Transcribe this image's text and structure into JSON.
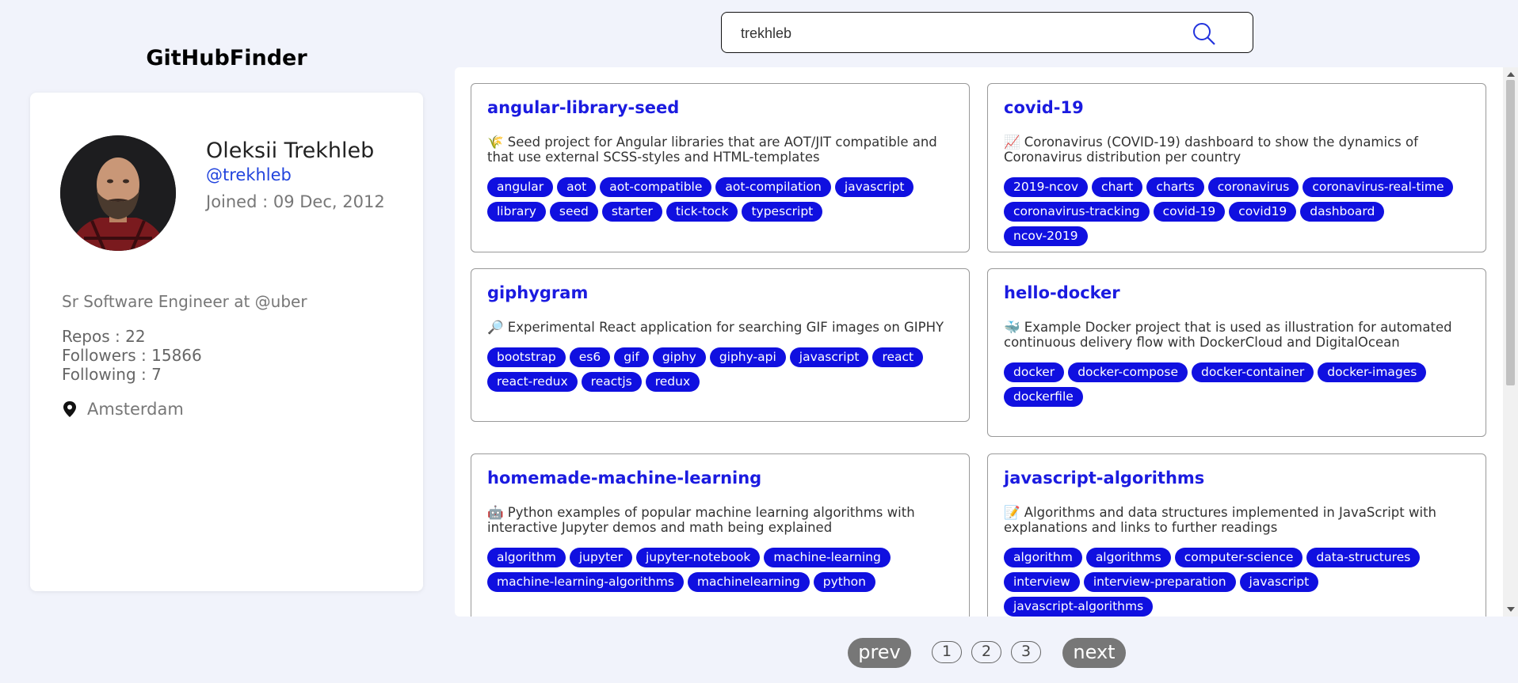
{
  "app": {
    "title": "GitHubFinder"
  },
  "search": {
    "value": "trekhleb"
  },
  "profile": {
    "name": "Oleksii Trekhleb",
    "login": "@trekhleb",
    "joined": "Joined : 09 Dec, 2012",
    "bio": "Sr Software Engineer at @uber",
    "repos": "Repos : 22",
    "followers": "Followers : 15866",
    "following": "Following : 7",
    "location": "Amsterdam"
  },
  "repos": [
    {
      "name": "angular-library-seed",
      "description": "🌾 Seed project for Angular libraries that are AOT/JIT compatible and that use external SCSS-styles and HTML-templates",
      "topics": [
        "angular",
        "aot",
        "aot-compatible",
        "aot-compilation",
        "javascript",
        "library",
        "seed",
        "starter",
        "tick-tock",
        "typescript"
      ]
    },
    {
      "name": "covid-19",
      "description": "📈 Coronavirus (COVID-19) dashboard to show the dynamics of Coronavirus distribution per country",
      "topics": [
        "2019-ncov",
        "chart",
        "charts",
        "coronavirus",
        "coronavirus-real-time",
        "coronavirus-tracking",
        "covid-19",
        "covid19",
        "dashboard",
        "ncov-2019"
      ]
    },
    {
      "name": "giphygram",
      "description": "🔎 Experimental React application for searching GIF images on GIPHY",
      "topics": [
        "bootstrap",
        "es6",
        "gif",
        "giphy",
        "giphy-api",
        "javascript",
        "react",
        "react-redux",
        "reactjs",
        "redux"
      ]
    },
    {
      "name": "hello-docker",
      "description": "🐳 Example Docker project that is used as illustration for automated continuous delivery flow with DockerCloud and DigitalOcean",
      "topics": [
        "docker",
        "docker-compose",
        "docker-container",
        "docker-images",
        "dockerfile"
      ]
    },
    {
      "name": "homemade-machine-learning",
      "description": "🤖 Python examples of popular machine learning algorithms with interactive Jupyter demos and math being explained",
      "topics": [
        "algorithm",
        "jupyter",
        "jupyter-notebook",
        "machine-learning",
        "machine-learning-algorithms",
        "machinelearning",
        "python"
      ]
    },
    {
      "name": "javascript-algorithms",
      "description": "📝 Algorithms and data structures implemented in JavaScript with explanations and links to further readings",
      "topics": [
        "algorithm",
        "algorithms",
        "computer-science",
        "data-structures",
        "interview",
        "interview-preparation",
        "javascript",
        "javascript-algorithms"
      ]
    }
  ],
  "pagination": {
    "prev": "prev",
    "next": "next",
    "pages": [
      "1",
      "2",
      "3"
    ]
  },
  "colors": {
    "accent": "#1010e0",
    "link": "#2244dd",
    "background": "#f1f3fb"
  }
}
